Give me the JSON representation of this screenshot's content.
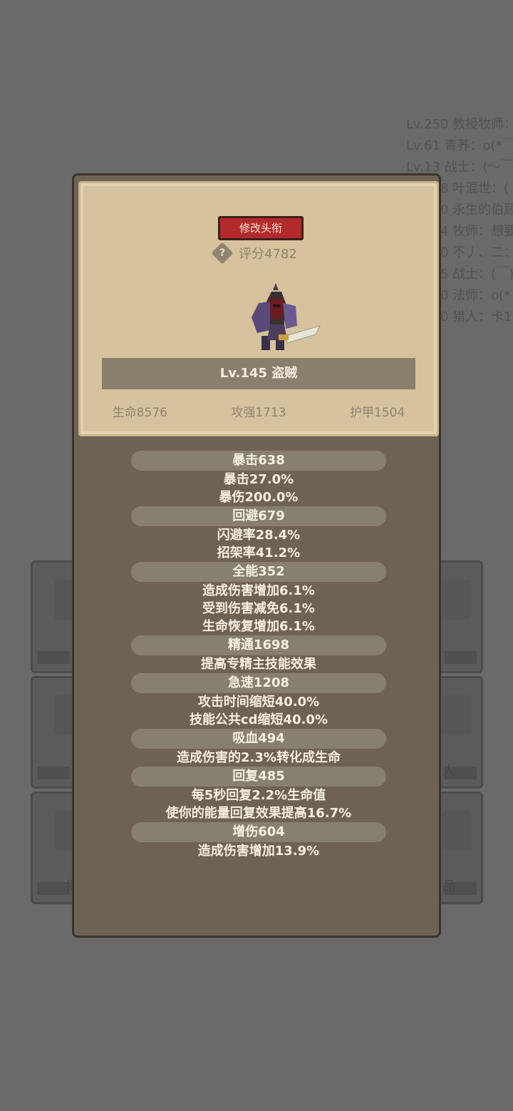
{
  "background": {
    "chat_lines": [
      "Lv.250 教授牧师：",
      "Lv.61 青荞：o(*￣",
      "Lv.13 战士：(～￣",
      "8 叶混世：(",
      "0 永生的伯顾",
      "4 牧师：想要",
      "0 不丿、二：",
      "5 战士：(￣)",
      "0 法师：o(*",
      "0 猎人：卡1"
    ],
    "slot_labels": [
      "人",
      "掃",
      "品"
    ]
  },
  "card": {
    "title_button": "修改头衔",
    "help_icon": "?",
    "score": "评分4782",
    "name": "Lv.145 盗贼",
    "base_stats": [
      "生命8576",
      "攻强1713",
      "护甲1504"
    ]
  },
  "stats": [
    {
      "head": "暴击638",
      "lines": [
        "暴击27.0%",
        "暴伤200.0%"
      ]
    },
    {
      "head": "回避679",
      "lines": [
        "闪避率28.4%",
        "招架率41.2%"
      ]
    },
    {
      "head": "全能352",
      "lines": [
        "造成伤害增加6.1%",
        "受到伤害减免6.1%",
        "生命恢复增加6.1%"
      ]
    },
    {
      "head": "精通1698",
      "lines": [
        "提高专精主技能效果"
      ]
    },
    {
      "head": "急速1208",
      "lines": [
        "攻击时间缩短40.0%",
        "技能公共cd缩短40.0%"
      ]
    },
    {
      "head": "吸血494",
      "lines": [
        "造成伤害的2.3%转化成生命"
      ]
    },
    {
      "head": "回复485",
      "lines": [
        "每5秒回复2.2%生命值",
        "使你的能量回复效果提高16.7%"
      ]
    },
    {
      "head": "增伤604",
      "lines": [
        "造成伤害增加13.9%"
      ]
    }
  ]
}
